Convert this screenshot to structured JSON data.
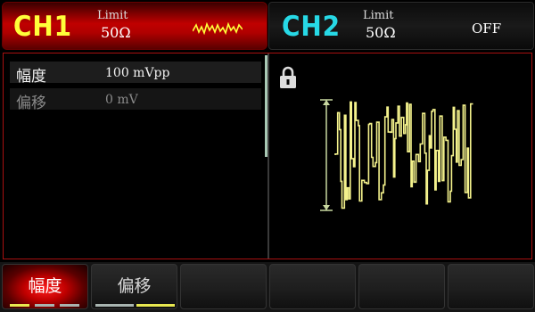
{
  "channels": [
    {
      "name": "CH1",
      "limit_label": "Limit",
      "impedance": "50Ω",
      "waveform_icon": "noise-wave-icon",
      "color": "#ffff3a",
      "active": true
    },
    {
      "name": "CH2",
      "limit_label": "Limit",
      "impedance": "50Ω",
      "status": "OFF",
      "color": "#27d9e6",
      "active": false
    }
  ],
  "params": [
    {
      "label": "幅度",
      "value": "100 mVpp",
      "selected": true
    },
    {
      "label": "偏移",
      "value": "0 mV",
      "selected": false
    }
  ],
  "preview": {
    "lock_icon": "lock-icon",
    "waveform": "noise",
    "waveform_color": "#f4f28c"
  },
  "softkeys": [
    {
      "label": "幅度",
      "active": true
    },
    {
      "label": "偏移",
      "active": false
    },
    {
      "label": ""
    },
    {
      "label": ""
    },
    {
      "label": ""
    },
    {
      "label": ""
    }
  ],
  "colors": {
    "ch1_header": "#c00000",
    "panel_border": "#a81010",
    "softkey_indicator_yellow": "#e8e850",
    "softkey_indicator_grey": "#a8b4b0"
  }
}
